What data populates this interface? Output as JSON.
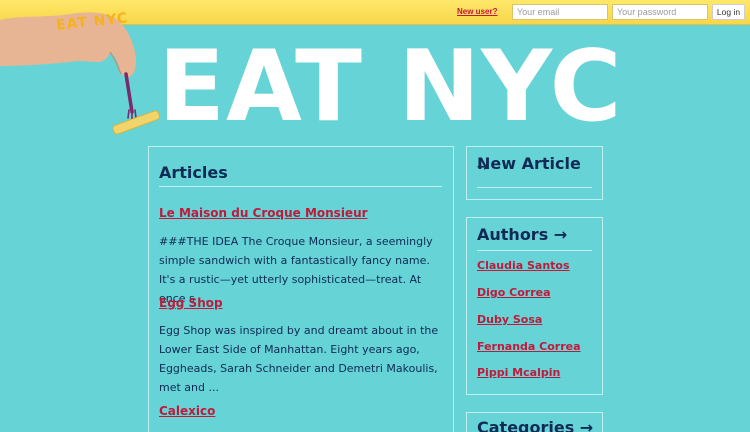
{
  "topbar": {
    "new_user_label": "New user?",
    "email_placeholder": "Your email",
    "password_placeholder": "Your password",
    "login_label": "Log in"
  },
  "hero": {
    "logo_text": "EAT NYC",
    "title": "EAT NYC"
  },
  "articles": {
    "title": "Articles",
    "items": [
      {
        "title": "Le Maison du Croque Monsieur",
        "excerpt": "###THE IDEA The Croque Monsieur, a seemingly simple sandwich with a fantastically fancy name. It's a rustic—yet utterly sophisticated—treat. At once s ..."
      },
      {
        "title": "Egg Shop",
        "excerpt": "Egg Shop was inspired by and dreamt about in the Lower East Side of Manhattan. Eight years ago, Eggheads, Sarah Schneider and Demetri Makoulis, met and ..."
      },
      {
        "title": "Calexico",
        "excerpt": ""
      }
    ]
  },
  "sidebar": {
    "new_article_label": "New Article",
    "new_article_arrow": "→",
    "authors_title": "Authors →",
    "authors": [
      "Claudia Santos",
      "Digo Correa",
      "Duby Sosa",
      "Fernanda Correa",
      "Pippi Mcalpin"
    ],
    "categories_title": "Categories →"
  },
  "colors": {
    "background": "#66d3d6",
    "topbar": "#f7d64b",
    "link": "#c01a3b",
    "heading": "#0f2a55"
  }
}
